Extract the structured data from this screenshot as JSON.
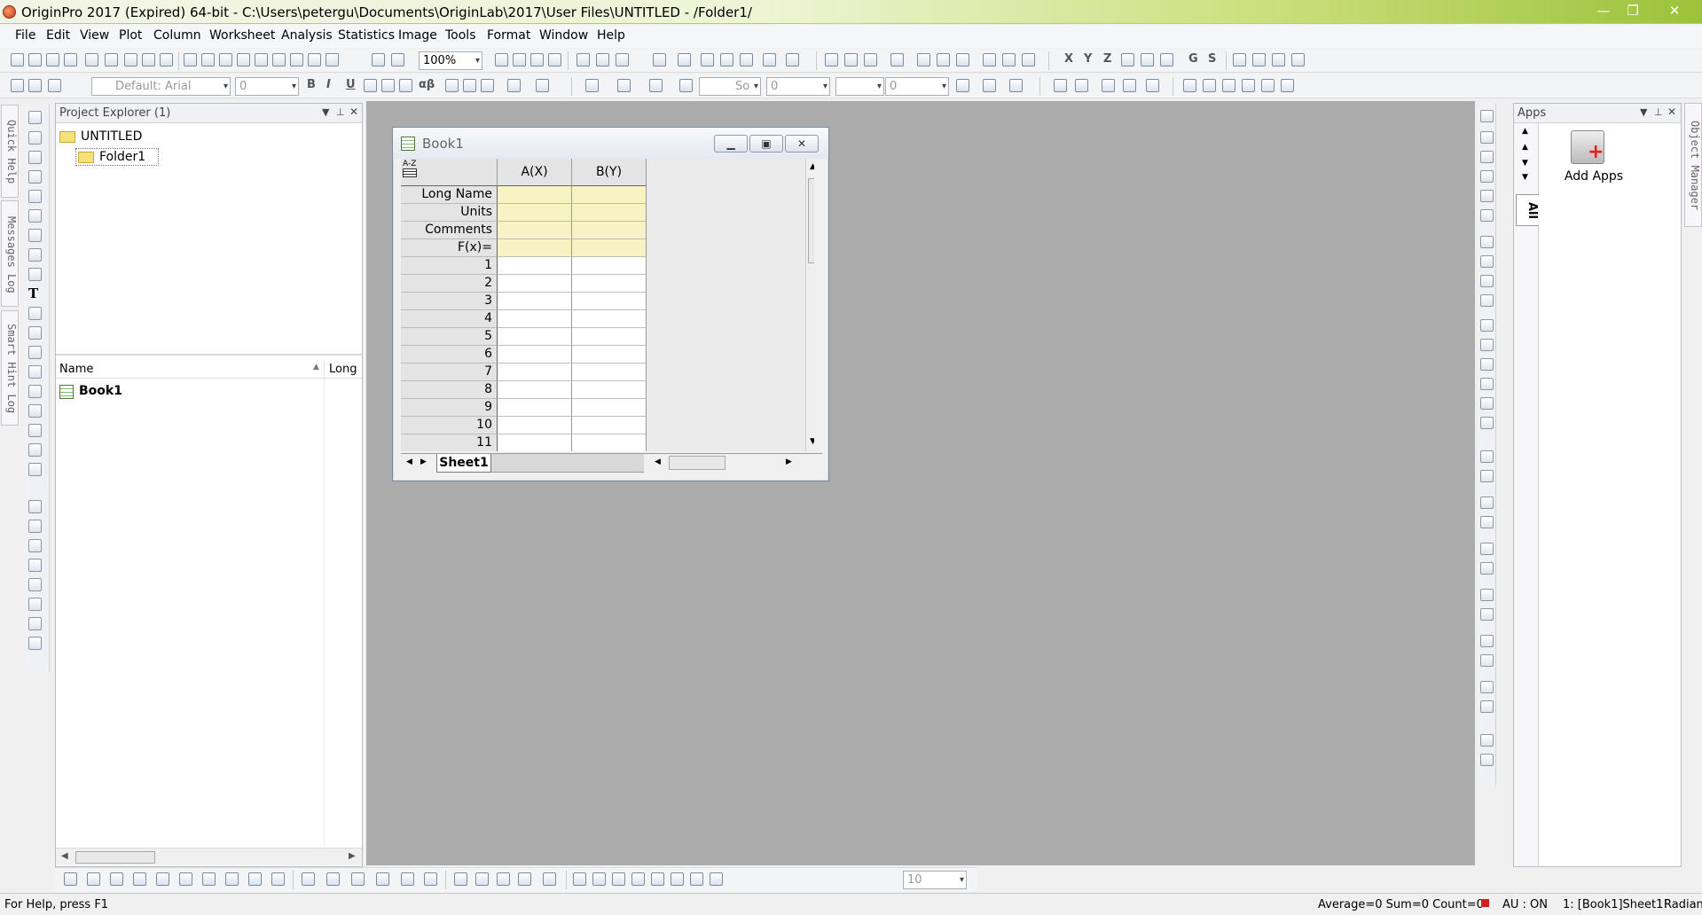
{
  "titlebar": {
    "title": "OriginPro 2017 (Expired) 64-bit - C:\\Users\\petergu\\Documents\\OriginLab\\2017\\User Files\\UNTITLED - /Folder1/",
    "minimize": "—",
    "restore": "❐",
    "close": "✕"
  },
  "menu": [
    "File",
    "Edit",
    "View",
    "Plot",
    "Column",
    "Worksheet",
    "Analysis",
    "Statistics",
    "Image",
    "Tools",
    "Format",
    "Window",
    "Help"
  ],
  "toolbar1": {
    "zoom": "100%",
    "letters": [
      "X",
      "Y",
      "Z",
      "G",
      "S"
    ]
  },
  "toolbar2": {
    "font": "Default: Arial",
    "font_size": "0",
    "bold": "B",
    "italic": "I",
    "underline": "U",
    "greek": "αβ",
    "line_style": "So",
    "line_width": "0",
    "value3": "0"
  },
  "left_tabs": [
    "Quick Help",
    "Messages Log",
    "Smart Hint Log"
  ],
  "project_explorer": {
    "title": "Project Explorer (1)",
    "root": "UNTITLED",
    "folder": "Folder1",
    "col_name": "Name",
    "col_long": "Long",
    "items": [
      "Book1"
    ]
  },
  "book": {
    "title": "Book1",
    "columns": [
      "A(X)",
      "B(Y)"
    ],
    "label_rows": [
      "Long Name",
      "Units",
      "Comments",
      "F(x)="
    ],
    "rows": [
      "1",
      "2",
      "3",
      "4",
      "5",
      "6",
      "7",
      "8",
      "9",
      "10",
      "11"
    ],
    "corner": "A-Z",
    "sheet_tab": "Sheet1"
  },
  "apps": {
    "title": "Apps",
    "tab": "All",
    "add_apps": "Add Apps"
  },
  "object_manager": "Object Manager",
  "bottom_toolbar": {
    "size": "10"
  },
  "statusbar": {
    "help": "For Help, press F1",
    "stats": "Average=0 Sum=0 Count=0",
    "au": "AU : ON",
    "sheet": "1: [Book1]Sheet1!",
    "angle": "Radian"
  }
}
